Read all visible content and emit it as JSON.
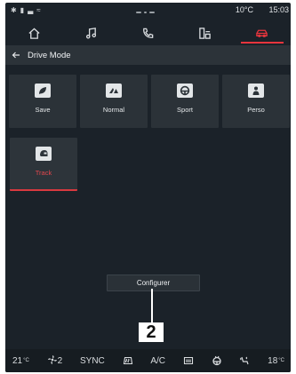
{
  "status": {
    "icons": [
      "bluetooth-icon",
      "battery-icon",
      "signal-icon",
      "wifi-icon"
    ],
    "temperature": "10°C",
    "time": "15:03"
  },
  "nav": {
    "items": [
      {
        "icon": "home-icon"
      },
      {
        "icon": "music-icon"
      },
      {
        "icon": "phone-icon"
      },
      {
        "icon": "apps-icon"
      },
      {
        "icon": "car-icon",
        "active": true
      }
    ],
    "active_color": "#e8353d"
  },
  "header": {
    "title": "Drive Mode"
  },
  "modes": [
    {
      "label": "Save",
      "icon": "leaf-icon"
    },
    {
      "label": "Normal",
      "icon": "logo-icon"
    },
    {
      "label": "Sport",
      "icon": "steering-wheel-icon"
    },
    {
      "label": "Perso",
      "icon": "person-icon"
    },
    {
      "label": "Track",
      "icon": "helmet-icon",
      "selected": true
    }
  ],
  "configure_label": "Configurer",
  "callout": "2",
  "bottom_bar": {
    "temp_left": "21",
    "temp_left_unit": "°C",
    "fan_speed": "2",
    "sync_label": "SYNC",
    "ac_label": "A/C",
    "temp_right": "18",
    "temp_right_unit": "°C"
  }
}
